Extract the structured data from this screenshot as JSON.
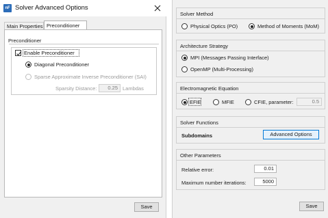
{
  "left": {
    "window_title": "Solver Advanced Options",
    "tabs": [
      "Main Properties",
      "Preconditioner"
    ],
    "group_title": "Preconditioner",
    "enable_preconditioner": {
      "label": "Enable Preconditioner",
      "checked": true
    },
    "diagonal": {
      "label": "Diagonal Preconditioner",
      "selected": true
    },
    "sai": {
      "label": "Sparse Approximate Inverse Preconditioner (SAI)",
      "selected": false,
      "enabled": false
    },
    "sparsity": {
      "label": "Sparsity Distance:",
      "value": "0.25",
      "unit": "Lambdas"
    },
    "save_label": "Save"
  },
  "right": {
    "solver_method": {
      "title": "Solver Method",
      "options": [
        "Physical Optics (PO)",
        "Method of Moments (MoM)"
      ],
      "selected": "Method of Moments (MoM)"
    },
    "architecture": {
      "title": "Architecture Strategy",
      "options": [
        "MPI (Messages Passing Interface)",
        "OpenMP (Multi-Processing)"
      ],
      "selected": "MPI (Messages Passing Interface)"
    },
    "em_equation": {
      "title": "Electromagnetic Equation",
      "options": [
        "EFIE",
        "MFIE",
        "CFIE, parameter:"
      ],
      "selected": "EFIE",
      "cfie_value": "0.5"
    },
    "solver_functions": {
      "title": "Solver Functions",
      "subdomains_label": "Subdomains",
      "advanced_button": "Advanced Options"
    },
    "other": {
      "title": "Other Parameters",
      "relative_error_label": "Relative error:",
      "relative_error_value": "0.01",
      "max_iter_label": "Maximum number iterations:",
      "max_iter_value": "5000"
    },
    "save_label": "Save"
  }
}
